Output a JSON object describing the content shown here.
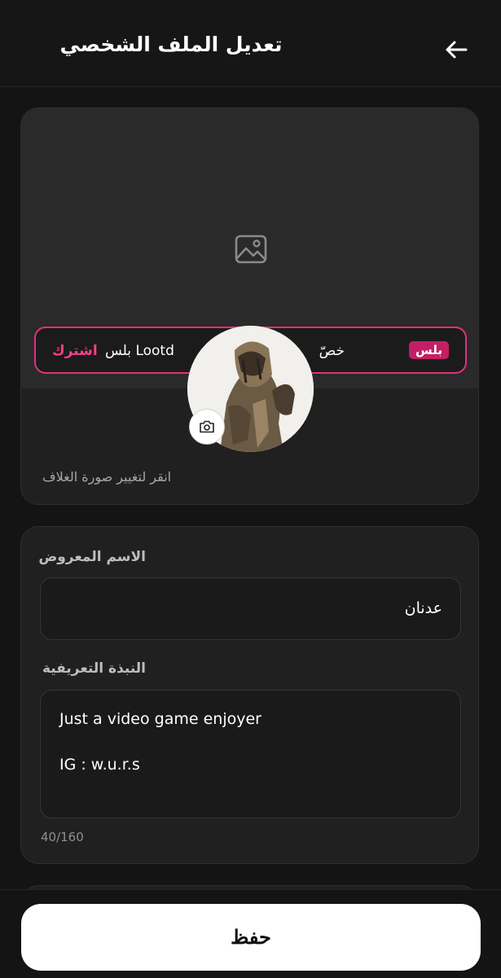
{
  "header": {
    "title": "تعديل الملف الشخصي"
  },
  "cover": {
    "caption": "انقر لتغيير صورة الغلاف"
  },
  "promo": {
    "badge": "بلس",
    "text_right": "خصّ",
    "text_left": "Lootd بلس",
    "cta": "اشترك"
  },
  "form": {
    "display_name_label": "الاسم المعروض",
    "display_name_value": "عدنان",
    "bio_label": "النبذة التعريفية",
    "bio_line1": "Just a video game enjoyer",
    "bio_line2": "IG : w.u.r.s",
    "bio_counter": "40/160"
  },
  "save_button": "حفظ",
  "colors": {
    "background": "#141414",
    "card": "#202020",
    "accent": "#e3307c",
    "badge": "#c41f64",
    "button": "#ffffff"
  },
  "icons": [
    "back-arrow-icon",
    "image-icon",
    "camera-icon"
  ]
}
